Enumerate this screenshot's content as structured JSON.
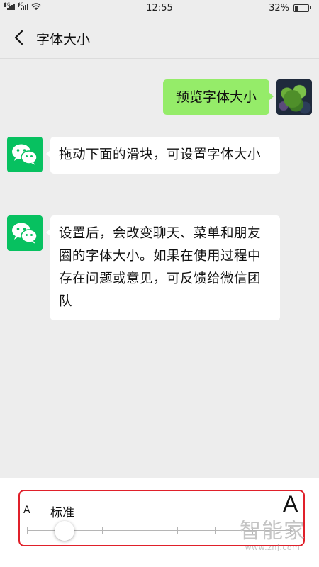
{
  "status_bar": {
    "network_left": "2G",
    "network_right": "4G",
    "time": "12:55",
    "battery_percent": "32%",
    "battery_level": 0.32
  },
  "nav": {
    "title": "字体大小"
  },
  "chat": {
    "self_message": "预览字体大小",
    "messages": [
      "拖动下面的滑块，可设置字体大小",
      "设置后，会改变聊天、菜单和朋友圈的字体大小。如果在使用过程中存在问题或意见，可反馈给微信团队"
    ]
  },
  "font_size_control": {
    "small_label": "A",
    "large_label": "A",
    "current_level_label": "标准",
    "selected_index": 1,
    "tick_count": 8
  },
  "watermark": {
    "text": "智能家",
    "url": "www.znj.com"
  },
  "colors": {
    "self_bubble": "#95ec69",
    "wechat_green": "#07c160",
    "highlight_border": "#e0202a",
    "background": "#ededed"
  }
}
